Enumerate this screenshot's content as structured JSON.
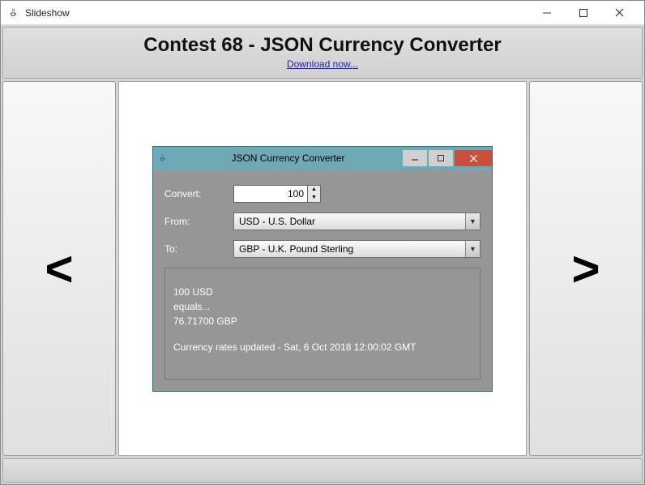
{
  "window": {
    "title": "Slideshow"
  },
  "header": {
    "title": "Contest 68 - JSON Currency Converter",
    "link_text": "Download now..."
  },
  "nav": {
    "prev": "<",
    "next": ">"
  },
  "inner": {
    "title": "JSON Currency Converter",
    "labels": {
      "convert": "Convert:",
      "from": "From:",
      "to": "To:"
    },
    "values": {
      "amount": "100",
      "from_option": "USD - U.S. Dollar",
      "to_option": "GBP - U.K. Pound Sterling"
    },
    "result": {
      "line1": "100 USD",
      "line2": "equals...",
      "line3": "76.71700 GBP",
      "updated": "Currency rates updated - Sat, 6 Oct 2018 12:00:02 GMT"
    }
  }
}
